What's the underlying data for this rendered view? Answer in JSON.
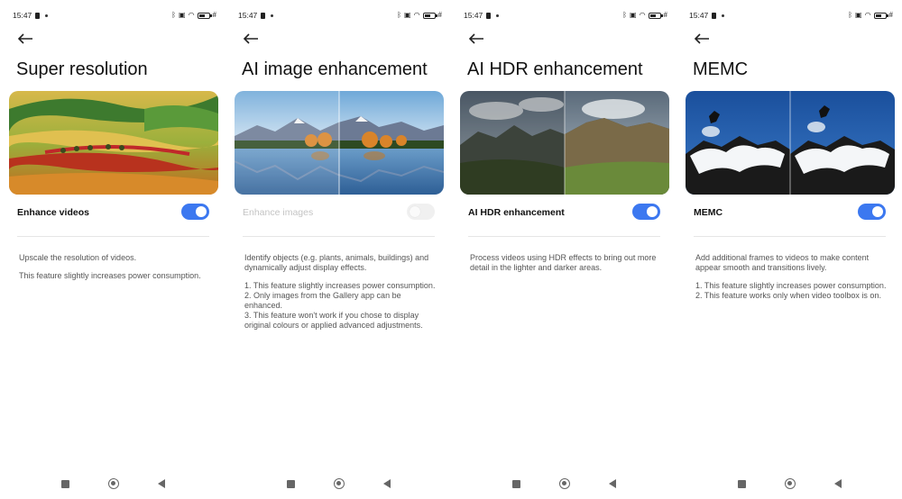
{
  "status": {
    "time": "15:47",
    "battery_level": 0.5
  },
  "screens": [
    {
      "title": "Super resolution",
      "setting_label": "Enhance videos",
      "toggle_on": true,
      "disabled": false,
      "description": [
        "Upscale the resolution of videos.",
        "This feature slightly increases power consumption."
      ]
    },
    {
      "title": "AI image enhancement",
      "setting_label": "Enhance images",
      "toggle_on": false,
      "disabled": true,
      "description": [
        "Identify objects (e.g. plants, animals, buildings) and dynamically adjust display effects.",
        "1. This feature slightly increases power consumption.\n2. Only images from the Gallery app can be enhanced.\n3. This feature won't work if you chose to display original colours or applied advanced adjustments."
      ]
    },
    {
      "title": "AI HDR enhancement",
      "setting_label": "AI HDR enhancement",
      "toggle_on": true,
      "disabled": false,
      "description": [
        "Process videos using HDR effects to bring out more detail in the lighter and darker areas."
      ]
    },
    {
      "title": "MEMC",
      "setting_label": "MEMC",
      "toggle_on": true,
      "disabled": false,
      "description": [
        "Add additional frames to videos to make content appear smooth and transitions lively.",
        "1. This feature slightly increases power consumption.\n2. This feature works only when video toolbox is on."
      ]
    }
  ],
  "colors": {
    "toggle_on": "#3c78f0",
    "toggle_off": "#f0f0f0",
    "text_primary": "#111111",
    "text_secondary": "#555555",
    "text_disabled": "#c4c4c4"
  },
  "icons": {
    "back": "arrow-left-icon",
    "nav_recent": "square-icon",
    "nav_home": "circle-icon",
    "nav_back": "triangle-back-icon"
  }
}
